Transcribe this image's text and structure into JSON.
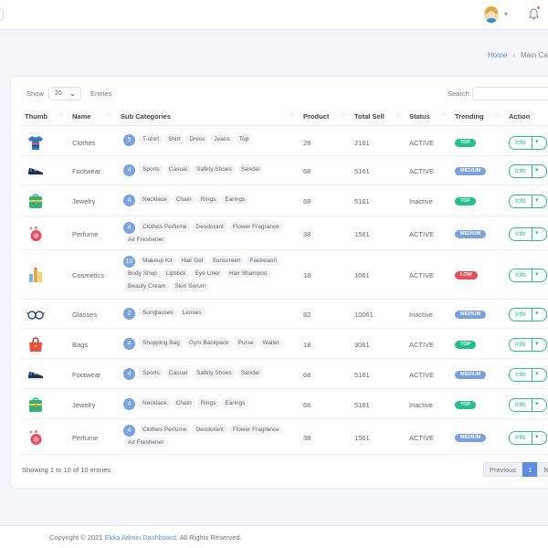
{
  "header": {
    "avatar_icon": "user-avatar",
    "caret_icon": "chevron-down-icon",
    "bell_icon": "bell-icon"
  },
  "breadcrumb": {
    "home": "Home",
    "separator": "›",
    "current": "Main Ca"
  },
  "controls": {
    "show_label": "Show",
    "page_size": "20",
    "entries_label": "Entries",
    "search_label": "Search:",
    "search_value": ""
  },
  "table": {
    "columns": [
      "Thumb",
      "Name",
      "Sub Categories",
      "Product",
      "Total Sell",
      "Status",
      "Trending",
      "Action"
    ],
    "rows": [
      {
        "icon": "tshirt-icon",
        "name": "Clothes",
        "count": "5",
        "subs": [
          "T-shirt",
          "Shirt",
          "Dress",
          "Jeans",
          "Top"
        ],
        "product": "28",
        "sell": "2161",
        "status": "ACTIVE",
        "trend": "TOP",
        "action": "Info"
      },
      {
        "icon": "sneaker-icon",
        "name": "Footwear",
        "count": "4",
        "subs": [
          "Sports",
          "Casual",
          "Safety Shoes",
          "Sandal"
        ],
        "product": "68",
        "sell": "5161",
        "status": "ACTIVE",
        "trend": "MEDIUM",
        "action": "Info"
      },
      {
        "icon": "jewelry-box-icon",
        "name": "Jewelry",
        "count": "4",
        "subs": [
          "Necklace",
          "Chain",
          "Rings",
          "Earings"
        ],
        "product": "68",
        "sell": "5161",
        "status": "Inactive",
        "trend": "TOP",
        "action": "Info"
      },
      {
        "icon": "perfume-bottle-icon",
        "name": "Perfume",
        "count": "4",
        "subs": [
          "Clothes Perfume",
          "Deodorant",
          "Flower Fragrance",
          "Air Freshener"
        ],
        "product": "38",
        "sell": "1561",
        "status": "ACTIVE",
        "trend": "MEDIUM",
        "action": "Info"
      },
      {
        "icon": "cosmetics-icon",
        "name": "Cosmetics",
        "count": "10",
        "subs": [
          "Makeup Kit",
          "Hair Gel",
          "Sunscreen",
          "Facewash",
          "Body Shop",
          "Lipstick",
          "Eye Liner",
          "Hair Shampoo",
          "Beauty Cream",
          "Skin Serum"
        ],
        "product": "18",
        "sell": "1061",
        "status": "ACTIVE",
        "trend": "LOW",
        "action": "Info"
      },
      {
        "icon": "glasses-icon",
        "name": "Glasses",
        "count": "2",
        "subs": [
          "Sunglasses",
          "Lenses"
        ],
        "product": "82",
        "sell": "10061",
        "status": "Inactive",
        "trend": "MEDIUM",
        "action": "Info"
      },
      {
        "icon": "handbag-icon",
        "name": "Bags",
        "count": "4",
        "subs": [
          "Shopping Bag",
          "Gym Backpack",
          "Purse",
          "Wallet"
        ],
        "product": "18",
        "sell": "3061",
        "status": "ACTIVE",
        "trend": "TOP",
        "action": "Info"
      },
      {
        "icon": "sneaker-icon",
        "name": "Footwear",
        "count": "4",
        "subs": [
          "Sports",
          "Casual",
          "Safety Shoes",
          "Sandal"
        ],
        "product": "68",
        "sell": "5161",
        "status": "ACTIVE",
        "trend": "MEDIUM",
        "action": "Info"
      },
      {
        "icon": "jewelry-box-icon",
        "name": "Jewelry",
        "count": "4",
        "subs": [
          "Necklace",
          "Chain",
          "Rings",
          "Earings"
        ],
        "product": "68",
        "sell": "5161",
        "status": "Inactive",
        "trend": "TOP",
        "action": "Info"
      },
      {
        "icon": "perfume-bottle-icon",
        "name": "Perfume",
        "count": "4",
        "subs": [
          "Clothes Perfume",
          "Deodorant",
          "Flower Fragrance",
          "Air Freshener"
        ],
        "product": "38",
        "sell": "1561",
        "status": "ACTIVE",
        "trend": "MEDIUM",
        "action": "Info"
      }
    ]
  },
  "pagination": {
    "info": "Showing 1 to 10 of 10 entries",
    "previous": "Previous",
    "current": "1",
    "next": "Ne"
  },
  "footer": {
    "prefix": "Copyright © 2021",
    "link": "Ekka Admin Dashboard",
    "suffix": ". All Rights Reserved."
  },
  "colors": {
    "accent": "#5a8de0",
    "success": "#1fc28f",
    "medium": "#7b9fe3",
    "danger": "#ef4c5a"
  }
}
